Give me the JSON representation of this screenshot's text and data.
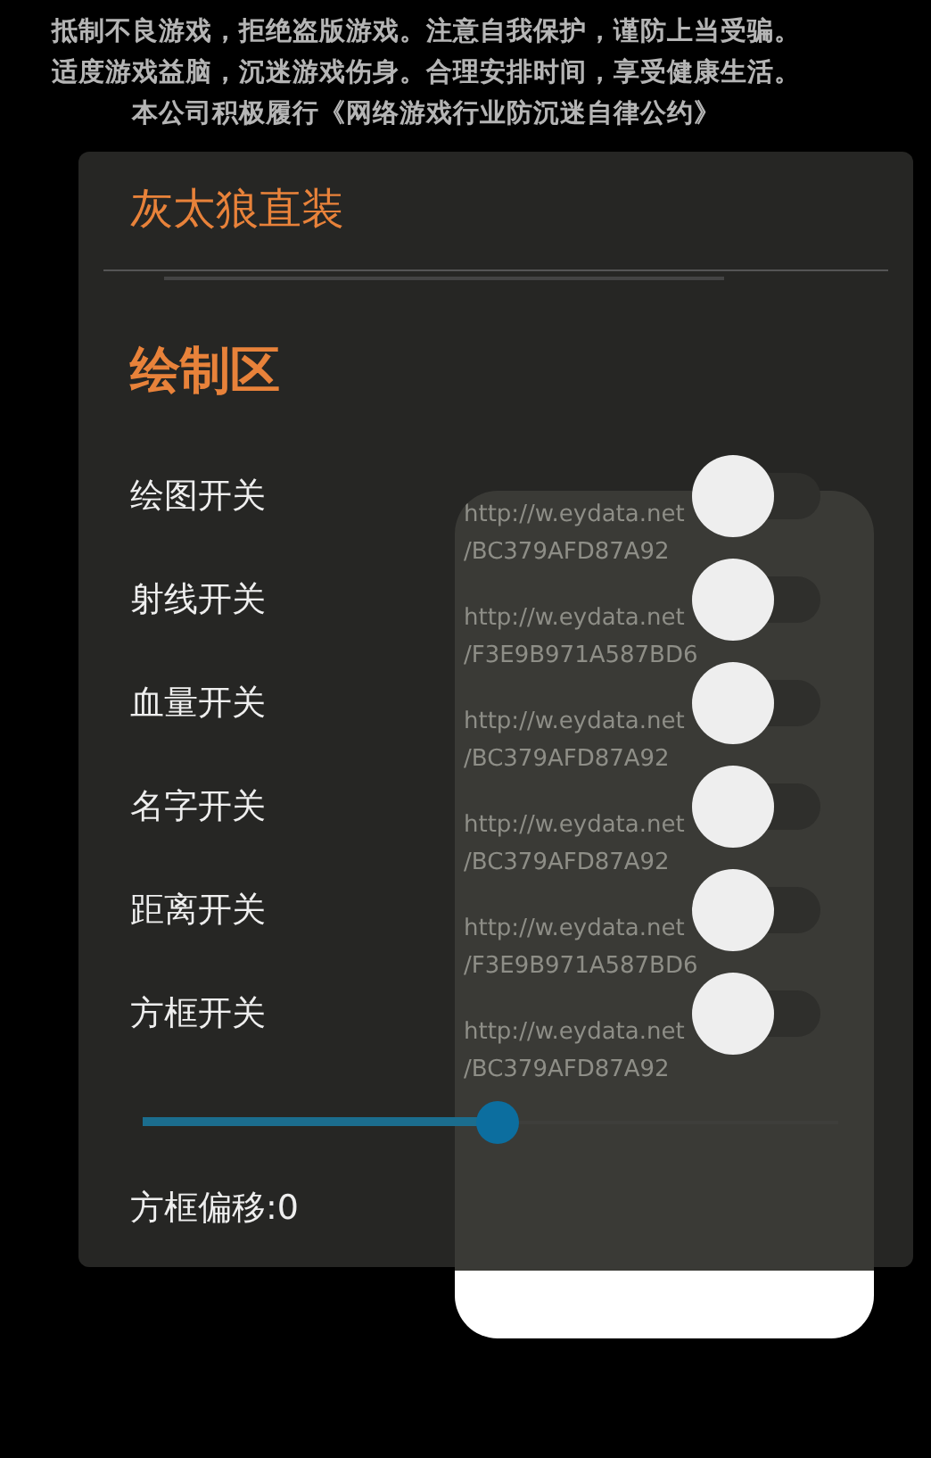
{
  "notice": [
    "抵制不良游戏，拒绝盗版游戏。注意自我保护，谨防上当受骗。",
    "适度游戏益脑，沉迷游戏伤身。合理安排时间，享受健康生活。",
    "本公司积极履行《网络游戏行业防沉迷自律公约》"
  ],
  "menu": {
    "title": "灰太狼直装",
    "section": "绘制区",
    "toggles": [
      {
        "label": "绘图开关",
        "on": false
      },
      {
        "label": "射线开关",
        "on": false
      },
      {
        "label": "血量开关",
        "on": false
      },
      {
        "label": "名字开关",
        "on": false
      },
      {
        "label": "距离开关",
        "on": false
      },
      {
        "label": "方框开关",
        "on": false
      }
    ],
    "slider": {
      "level": 0.51
    },
    "slider_label": "方框偏移:0"
  },
  "overlay": {
    "lines": [
      "http://w.eydata.net",
      "/BC379AFD87A92",
      "http://w.eydata.net",
      "/F3E9B971A587BD6",
      "http://w.eydata.net",
      "/BC379AFD87A92",
      "http://w.eydata.net",
      "/BC379AFD87A92",
      "http://w.eydata.net",
      "/F3E9B971A587BD6",
      "http://w.eydata.net",
      "/BC379AFD87A92"
    ]
  }
}
